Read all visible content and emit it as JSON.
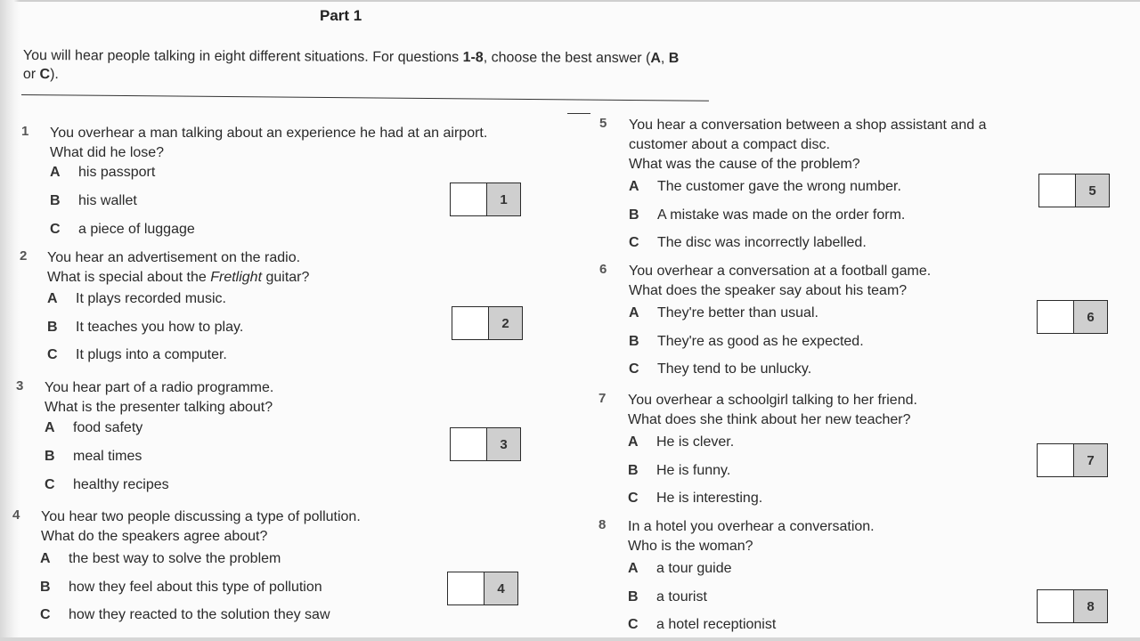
{
  "header": {
    "title": "Part 1",
    "instructions": {
      "text_1": "You will hear people talking in eight different situations. For questions ",
      "range": "1-8",
      "text_2": ", choose the best answer (",
      "opt_a": "A",
      "sep_1": ", ",
      "opt_b": "B",
      "sep_2": " or ",
      "opt_c": "C",
      "text_3": ")."
    }
  },
  "questions": [
    {
      "number": "1",
      "lines": [
        "You overhear a man talking about an experience he had at an airport.",
        "What did he lose?"
      ],
      "options": [
        {
          "letter": "A",
          "text": "his passport"
        },
        {
          "letter": "B",
          "text": "his wallet"
        },
        {
          "letter": "C",
          "text": "a piece of luggage"
        }
      ],
      "answer_box": {
        "label": "1",
        "value": ""
      }
    },
    {
      "number": "2",
      "lines": [
        "You hear an advertisement on the radio."
      ],
      "line2_parts": {
        "before": "What is special about the ",
        "italic": "Fretlight",
        "after": " guitar?"
      },
      "options": [
        {
          "letter": "A",
          "text": "It plays recorded music."
        },
        {
          "letter": "B",
          "text": "It teaches you how to play."
        },
        {
          "letter": "C",
          "text": "It plugs into a computer."
        }
      ],
      "answer_box": {
        "label": "2",
        "value": ""
      }
    },
    {
      "number": "3",
      "lines": [
        "You hear part of a radio programme.",
        "What is the presenter talking about?"
      ],
      "options": [
        {
          "letter": "A",
          "text": "food safety"
        },
        {
          "letter": "B",
          "text": "meal times"
        },
        {
          "letter": "C",
          "text": "healthy recipes"
        }
      ],
      "answer_box": {
        "label": "3",
        "value": ""
      }
    },
    {
      "number": "4",
      "lines": [
        "You hear two people discussing a type of pollution.",
        "What do the speakers agree about?"
      ],
      "options": [
        {
          "letter": "A",
          "text": "the best way to solve the problem"
        },
        {
          "letter": "B",
          "text": "how they feel about this type of pollution"
        },
        {
          "letter": "C",
          "text": "how they reacted to the solution they saw"
        }
      ],
      "answer_box": {
        "label": "4",
        "value": ""
      }
    },
    {
      "number": "5",
      "lines": [
        "You hear a conversation between a shop assistant and a",
        "customer about a compact disc.",
        "What was the cause of the problem?"
      ],
      "options": [
        {
          "letter": "A",
          "text": "The customer gave the wrong number."
        },
        {
          "letter": "B",
          "text": "A mistake was made on the order form."
        },
        {
          "letter": "C",
          "text": "The disc was incorrectly labelled."
        }
      ],
      "answer_box": {
        "label": "5",
        "value": ""
      }
    },
    {
      "number": "6",
      "lines": [
        "You overhear a conversation at a football game.",
        "What does the speaker say about his team?"
      ],
      "options": [
        {
          "letter": "A",
          "text": "They're better than usual."
        },
        {
          "letter": "B",
          "text": "They're as good as he expected."
        },
        {
          "letter": "C",
          "text": "They tend to be unlucky."
        }
      ],
      "answer_box": {
        "label": "6",
        "value": ""
      }
    },
    {
      "number": "7",
      "lines": [
        "You overhear a schoolgirl talking to her friend.",
        "What does she think about her new teacher?"
      ],
      "options": [
        {
          "letter": "A",
          "text": "He is clever."
        },
        {
          "letter": "B",
          "text": "He is funny."
        },
        {
          "letter": "C",
          "text": "He is interesting."
        }
      ],
      "answer_box": {
        "label": "7",
        "value": ""
      }
    },
    {
      "number": "8",
      "lines": [
        "In a hotel you overhear a conversation.",
        "Who is the woman?"
      ],
      "options": [
        {
          "letter": "A",
          "text": "a tour guide"
        },
        {
          "letter": "B",
          "text": "a tourist"
        },
        {
          "letter": "C",
          "text": "a hotel receptionist"
        }
      ],
      "answer_box": {
        "label": "8",
        "value": ""
      }
    }
  ]
}
